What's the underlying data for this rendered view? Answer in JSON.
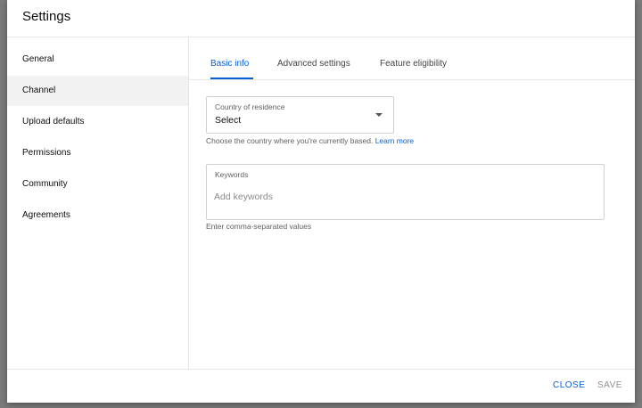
{
  "dialog": {
    "title": "Settings"
  },
  "sidebar": {
    "items": [
      {
        "label": "General"
      },
      {
        "label": "Channel"
      },
      {
        "label": "Upload defaults"
      },
      {
        "label": "Permissions"
      },
      {
        "label": "Community"
      },
      {
        "label": "Agreements"
      }
    ],
    "active": "Channel"
  },
  "tabs": [
    {
      "label": "Basic info"
    },
    {
      "label": "Advanced settings"
    },
    {
      "label": "Feature eligibility"
    }
  ],
  "country": {
    "label": "Country of residence",
    "value": "Select",
    "helper": "Choose the country where you're currently based.",
    "learn_more": "Learn more"
  },
  "keywords": {
    "label": "Keywords",
    "placeholder": "Add keywords",
    "helper": "Enter comma-separated values"
  },
  "footer": {
    "close_label": "CLOSE",
    "save_label": "SAVE"
  },
  "colors": {
    "accent": "#065fd4",
    "disabled": "#909090",
    "active_sidebar_bg": "#f2f2f2"
  }
}
